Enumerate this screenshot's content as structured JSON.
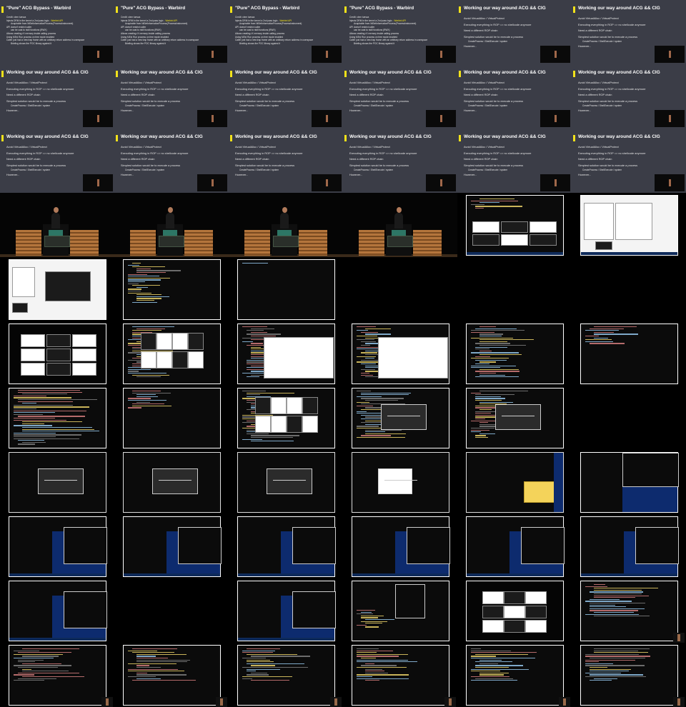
{
  "slides": [
    {
      "title": "\"Pure\" ACG Bypass - Warbird",
      "bullets": [
        {
          "text": "Credit: clem tuesca",
          "kind": "normal"
        },
        {
          "text": "Injects DRM in the kernel a 2nd pass logic - ",
          "link": "Warbird API",
          "kind": "normal"
        },
        {
          "text": "Acquirable from NtSetInformationProcess(ProcessInstrument)",
          "kind": "sub"
        },
        {
          "text": "API doesn't restrict caller",
          "kind": "normal"
        },
        {
          "text": "can be cast to ntdll functions (RWX)",
          "kind": "sub"
        },
        {
          "text": "Allows creating rX memory inside calling process",
          "kind": "normal"
        },
        {
          "text": "Using MEs! Run process on free mode enabled",
          "kind": "normal"
        },
        {
          "text": "Caller just had a new trap frame with an arbitrary return address in userspace",
          "kind": "normal"
        },
        {
          "text": "Briefing shows the POC library against it",
          "kind": "sub"
        }
      ]
    },
    {
      "title": "Working our way around ACG && CIG",
      "bullets": [
        {
          "text": "Avoid VirtualAlloc / VirtualProtect",
          "kind": "big"
        },
        {
          "text": "Executing everything in ROP => no shellcode anymore",
          "kind": "big"
        },
        {
          "text": "Need a different ROP chain",
          "kind": "big"
        },
        {
          "text": "Simplest solution would be to execute a process",
          "kind": "big"
        },
        {
          "text": "CreateProcess / ShellExecute / system",
          "kind": "sub"
        },
        {
          "text": "However...",
          "kind": "big"
        }
      ]
    }
  ],
  "cells": [
    "s0",
    "s0",
    "s0",
    "s0",
    "s1",
    "s1",
    "s1",
    "s1",
    "s1",
    "s1",
    "s1",
    "s1",
    "s1",
    "s1",
    "s1",
    "s1",
    "s1",
    "s1",
    "stage",
    "stage",
    "stage",
    "stage",
    "desktop-windows",
    "file-explorer",
    "explorer-dialog",
    "terminal-code",
    "dark-screen",
    "black",
    "black",
    "black",
    "window-grid",
    "window-grid-code",
    "explorer-code",
    "explorer-code",
    "code",
    "code-sparse",
    "code-dense",
    "code-sparse",
    "window-grid-code",
    "dialog-code",
    "dialog-code",
    "black",
    "dialog",
    "dialog",
    "dialog",
    "dialog-small",
    "yellow-alert",
    "terminal-desktop",
    "terminal-blue",
    "terminal-blue",
    "terminal-blue",
    "terminal-blue",
    "terminal-blue",
    "terminal-blue",
    "terminal-blue",
    "black",
    "terminal-blue",
    "terminal-small",
    "window-grid-white",
    "terminal-text",
    "terminal-text",
    "terminal-text",
    "terminal-text",
    "terminal-text",
    "terminal-text",
    "terminal-text"
  ],
  "colors": {
    "slide_bg": "#3b3d47",
    "accent": "#f2e21a",
    "desktop_blue": "#0d2b6e",
    "podium_wood": "#b4753c"
  }
}
